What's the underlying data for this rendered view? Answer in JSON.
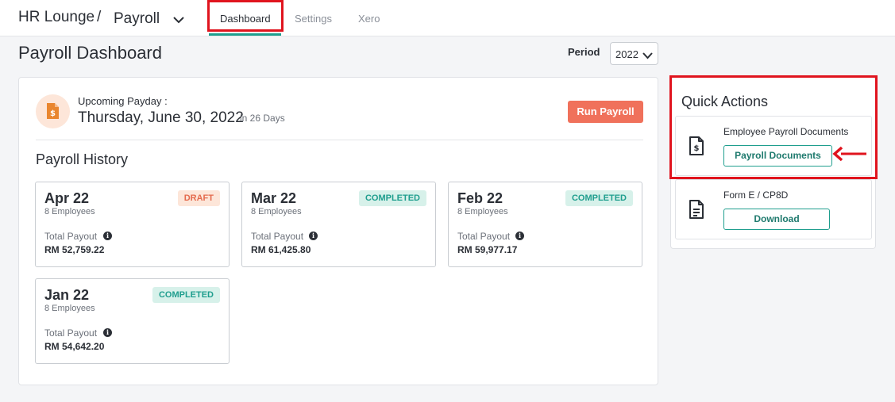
{
  "header": {
    "brand": "HR Lounge",
    "separator": "/",
    "module": "Payroll",
    "tabs": [
      {
        "label": "Dashboard",
        "active": true
      },
      {
        "label": "Settings",
        "active": false
      },
      {
        "label": "Xero",
        "active": false
      }
    ]
  },
  "page": {
    "title": "Payroll Dashboard",
    "period_label": "Period",
    "period_value": "2022"
  },
  "payday": {
    "label": "Upcoming Payday :",
    "date": "Thursday, June 30, 2022",
    "days": "in 26 Days",
    "run_button": "Run Payroll"
  },
  "history": {
    "title": "Payroll History",
    "cards": [
      {
        "month": "Apr 22",
        "employees": "8 Employees",
        "status": "DRAFT",
        "payout_label": "Total Payout",
        "amount": "RM 52,759.22"
      },
      {
        "month": "Mar 22",
        "employees": "8 Employees",
        "status": "COMPLETED",
        "payout_label": "Total Payout",
        "amount": "RM 61,425.80"
      },
      {
        "month": "Feb 22",
        "employees": "8 Employees",
        "status": "COMPLETED",
        "payout_label": "Total Payout",
        "amount": "RM 59,977.17"
      },
      {
        "month": "Jan 22",
        "employees": "8 Employees",
        "status": "COMPLETED",
        "payout_label": "Total Payout",
        "amount": "RM 54,642.20"
      }
    ]
  },
  "quick_actions": {
    "title": "Quick Actions",
    "items": [
      {
        "label": "Employee Payroll Documents",
        "button": "Payroll Documents",
        "icon": "invoice-dollar-icon"
      },
      {
        "label": "Form E / CP8D",
        "button": "Download",
        "icon": "document-icon"
      }
    ]
  },
  "colors": {
    "accent": "#1f9e8e",
    "run_button": "#f0715b",
    "highlight": "#e0141e"
  }
}
